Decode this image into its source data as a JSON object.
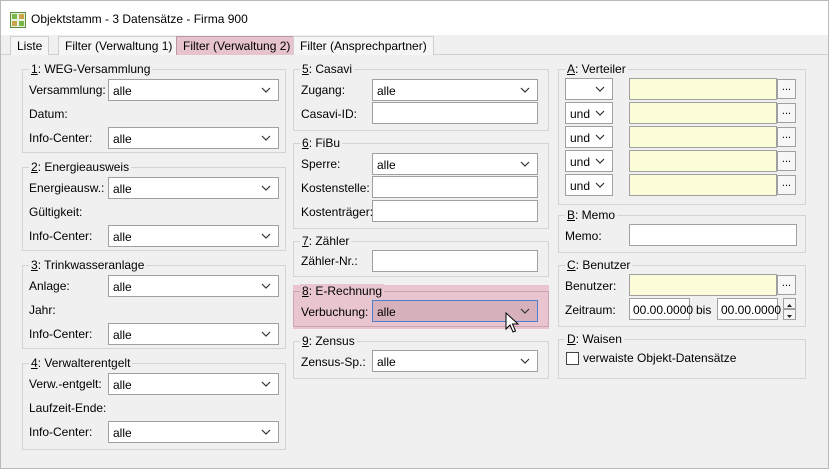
{
  "window": {
    "title": "Objektstamm - 3 Datensätze - Firma 900"
  },
  "tabs": [
    {
      "label": "Liste"
    },
    {
      "label": "Filter (Verwaltung 1)"
    },
    {
      "label": "Filter (Verwaltung 2)"
    },
    {
      "label": "Filter (Ansprechpartner)"
    }
  ],
  "weg": {
    "num": "1",
    "title": ": WEG-Versammlung",
    "versammlung_label": "Versammlung:",
    "versammlung_value": "alle",
    "datum_label": "Datum:",
    "infocenter_label": "Info-Center:",
    "infocenter_value": "alle"
  },
  "energie": {
    "num": "2",
    "title": ": Energieausweis",
    "ausweis_label": "Energieausw.:",
    "ausweis_value": "alle",
    "gueltigkeit_label": "Gültigkeit:",
    "infocenter_label": "Info-Center:",
    "infocenter_value": "alle"
  },
  "trinkwasser": {
    "num": "3",
    "title": ": Trinkwasseranlage",
    "anlage_label": "Anlage:",
    "anlage_value": "alle",
    "jahr_label": "Jahr:",
    "infocenter_label": "Info-Center:",
    "infocenter_value": "alle"
  },
  "verwalterentgelt": {
    "num": "4",
    "title": ": Verwalterentgelt",
    "entgelt_label": "Verw.-entgelt:",
    "entgelt_value": "alle",
    "laufzeit_label": "Laufzeit-Ende:",
    "infocenter_label": "Info-Center:",
    "infocenter_value": "alle"
  },
  "casavi": {
    "num": "5",
    "title": ": Casavi",
    "zugang_label": "Zugang:",
    "zugang_value": "alle",
    "id_label": "Casavi-ID:"
  },
  "fibu": {
    "num": "6",
    "title": ": FiBu",
    "sperre_label": "Sperre:",
    "sperre_value": "alle",
    "kostenstelle_label": "Kostenstelle:",
    "kostentraeger_label": "Kostenträger:"
  },
  "zaehler": {
    "num": "7",
    "title": ": Zähler",
    "nr_label": "Zähler-Nr.:"
  },
  "erechnung": {
    "num": "8",
    "title": ": E-Rechnung",
    "verbuchung_label": "Verbuchung:",
    "verbuchung_value": "alle"
  },
  "zensus": {
    "num": "9",
    "title": ": Zensus",
    "sp_label": "Zensus-Sp.:",
    "sp_value": "alle"
  },
  "verteiler": {
    "num": "A",
    "title": ": Verteiler",
    "rows": [
      {
        "op": "",
        "button": "..."
      },
      {
        "op": "und",
        "button": "..."
      },
      {
        "op": "und",
        "button": "..."
      },
      {
        "op": "und",
        "button": "..."
      },
      {
        "op": "und",
        "button": "..."
      }
    ]
  },
  "memo": {
    "num": "B",
    "title": ": Memo",
    "memo_label": "Memo:"
  },
  "benutzer": {
    "num": "C",
    "title": ": Benutzer",
    "benutzer_label": "Benutzer:",
    "button": "...",
    "zeitraum_label": "Zeitraum:",
    "from_value": "00.00.0000",
    "bis_label": "bis",
    "to_value": "00.00.0000"
  },
  "waisen": {
    "num": "D",
    "title": ": Waisen",
    "checkbox_label": "verwaiste Objekt-Datensätze"
  }
}
